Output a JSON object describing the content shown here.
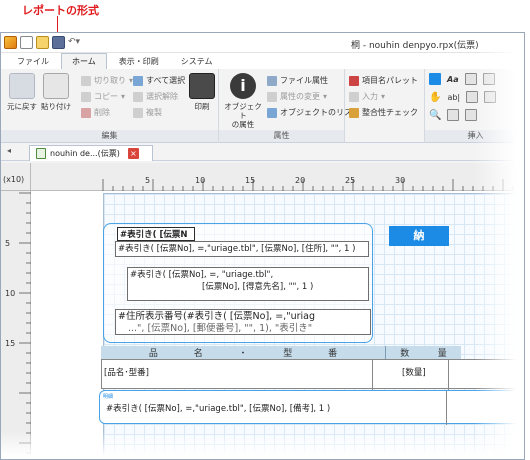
{
  "callout": {
    "label": "レポートの形式"
  },
  "window": {
    "title": "桐 - nouhin denpyo.rpx(伝票)"
  },
  "tabs": [
    "ファイル",
    "ホーム",
    "表示・印刷",
    "システム"
  ],
  "ribbon": {
    "undo_label": "元に戻す",
    "paste_label": "貼り付け",
    "cut_label": "切り取り",
    "copy_label": "コピー",
    "delete_label": "削除",
    "select_all_label": "すべて選択",
    "deselect_label": "選択解除",
    "duplicate_label": "複製",
    "print_label": "印刷",
    "group_edit": "編集",
    "object_props_label": "オブジェクト\nの属性",
    "file_props_label": "ファイル属性",
    "change_props_label": "属性の変更",
    "object_list_label": "オブジェクトのリスト",
    "group_props": "属性",
    "item_palette_label": "項目名パレット",
    "input_label": "入力",
    "consistency_label": "整合性チェック",
    "group_insert": "挿入"
  },
  "document_tab": {
    "label": "nouhin de...(伝票)",
    "close_label": "×"
  },
  "ruler": {
    "unit_label": "(x10)",
    "h_labels": [
      "5",
      "10",
      "15",
      "20",
      "25",
      "30"
    ],
    "v_labels": [
      "5",
      "10",
      "15"
    ]
  },
  "report": {
    "selected_field": "#表引き( [伝票N",
    "field_address": "#表引き( [伝票No], =,\"uriage.tbl\", [伝票No], [住所], \"\", 1 )",
    "field_customer_line1": "#表引き( [伝票No], =, \"uriage.tbl\",",
    "field_customer_line2": "[伝票No], [得意先名], \"\", 1 )",
    "field_zip_line1": "#住所表示番号(#表引き( [伝票No], =,\"uriag",
    "field_zip_line2": "...\", [伝票No], [郵便番号], \"\", 1), \"表引き\"",
    "badge_label": "納",
    "header_chars": [
      "品",
      "名",
      "・",
      "型",
      "番"
    ],
    "header_qty_chars": [
      "数",
      "量"
    ],
    "row_item_label": "[品名･型番]",
    "row_qty_label": "[数量]",
    "footer_tag": "明細",
    "footer_formula": "#表引き( [伝票No], =,\"uriage.tbl\", [伝票No], [備考], 1 )"
  }
}
